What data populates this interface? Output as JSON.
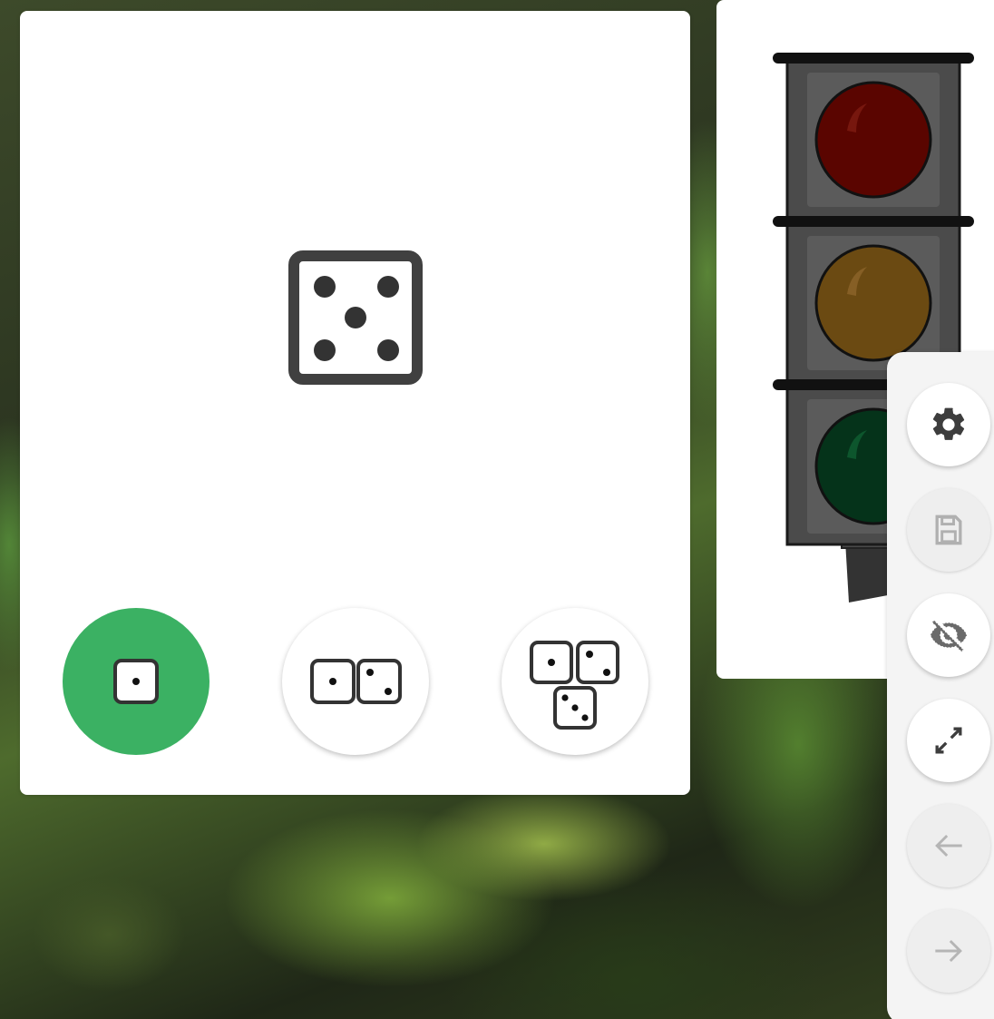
{
  "dice_widget": {
    "current_roll": 5,
    "dice_count_options": [
      {
        "dice": 1,
        "faces": [
          1
        ],
        "selected": true
      },
      {
        "dice": 2,
        "faces": [
          1,
          2
        ],
        "selected": false
      },
      {
        "dice": 3,
        "faces": [
          1,
          2,
          3
        ],
        "selected": false
      }
    ],
    "accent_color": "#3bb163"
  },
  "traffic_light_widget": {
    "lights": [
      {
        "color": "red",
        "hex": "#5a0500",
        "lit": false
      },
      {
        "color": "amber",
        "hex": "#6b4a12",
        "lit": false
      },
      {
        "color": "green",
        "hex": "#05331a",
        "lit": false
      }
    ]
  },
  "toolbar": {
    "buttons": [
      {
        "icon": "gear-icon",
        "enabled": true
      },
      {
        "icon": "save-icon",
        "enabled": false
      },
      {
        "icon": "visibility-off-icon",
        "enabled": true
      },
      {
        "icon": "expand-icon",
        "enabled": true
      },
      {
        "icon": "arrow-left-icon",
        "enabled": false
      },
      {
        "icon": "arrow-right-icon",
        "enabled": false
      }
    ]
  }
}
